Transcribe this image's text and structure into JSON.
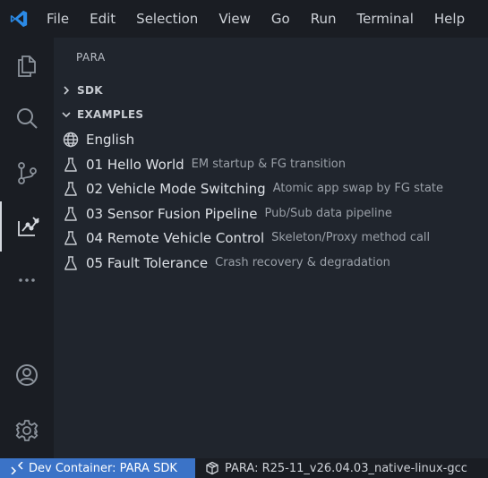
{
  "menu": [
    "File",
    "Edit",
    "Selection",
    "View",
    "Go",
    "Run",
    "Terminal",
    "Help"
  ],
  "activity_bar": {
    "icons": [
      "explorer-icon",
      "search-icon",
      "source-control-icon",
      "para-extension-icon",
      "more-icon"
    ],
    "bottom_icons": [
      "account-icon",
      "settings-gear-icon"
    ],
    "active": "para-extension-icon"
  },
  "sidebar": {
    "title": "PARA",
    "sections": [
      {
        "label": "SDK",
        "expanded": false
      },
      {
        "label": "EXAMPLES",
        "expanded": true
      }
    ],
    "items": [
      {
        "icon": "globe-icon",
        "label": "English",
        "desc": ""
      },
      {
        "icon": "beaker-icon",
        "label": "01 Hello World",
        "desc": "EM startup & FG transition"
      },
      {
        "icon": "beaker-icon",
        "label": "02 Vehicle Mode Switching",
        "desc": "Atomic app swap by FG state"
      },
      {
        "icon": "beaker-icon",
        "label": "03 Sensor Fusion Pipeline",
        "desc": "Pub/Sub data pipeline"
      },
      {
        "icon": "beaker-icon",
        "label": "04 Remote Vehicle Control",
        "desc": "Skeleton/Proxy method call"
      },
      {
        "icon": "beaker-icon",
        "label": "05 Fault Tolerance",
        "desc": "Crash recovery & degradation"
      }
    ]
  },
  "statusbar": {
    "remote_label": "Dev Container: PARA SDK",
    "sdk_label": "PARA: R25-11_v26.04.03_native-linux-gcc"
  },
  "colors": {
    "accent": "#3b73c7",
    "vscode_logo": "#2b8ae6"
  }
}
